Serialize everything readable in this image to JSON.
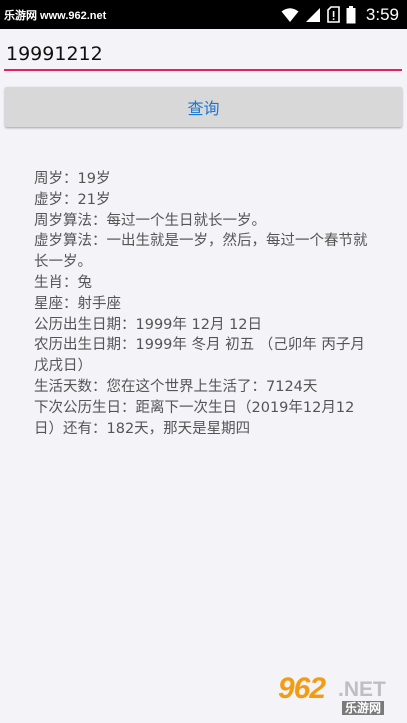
{
  "status_bar": {
    "watermark": "乐游网 www.962.net",
    "clock": "3:59",
    "icons": [
      "wifi-icon",
      "signal-icon",
      "no-sim-icon",
      "battery-icon"
    ]
  },
  "input": {
    "value": "19991212"
  },
  "query_button": {
    "label": "查询"
  },
  "result_lines": [
    "周岁：19岁",
    "虚岁：21岁",
    "周岁算法：每过一个生日就长一岁。",
    "虚岁算法：一出生就是一岁，然后，每过一个春节就长一岁。",
    "生肖：兔",
    "星座：射手座",
    "公历出生日期：1999年 12月 12日",
    "农历出生日期：1999年 冬月 初五 （己卯年 丙子月 戊戌日）",
    "生活天数：您在这个世界上生活了：7124天",
    "下次公历生日：距离下一次生日（2019年12月12日）还有：182天，那天是星期四"
  ],
  "logo": {
    "number": "962",
    "suffix": ".NET",
    "chinese": "乐游网"
  },
  "colors": {
    "accent": "#e91e63",
    "button_text": "#1976d2",
    "background": "#f4f3f8"
  }
}
